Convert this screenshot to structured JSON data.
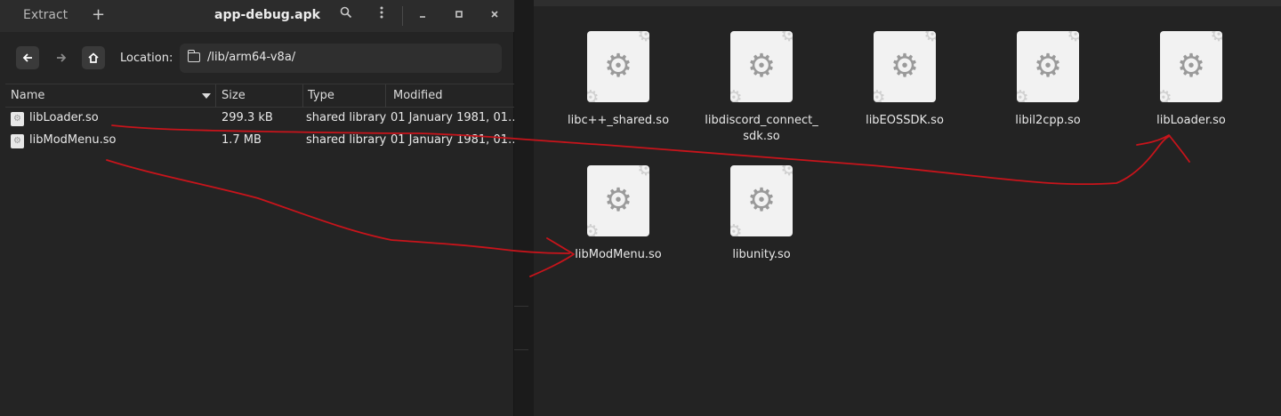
{
  "archive": {
    "title": "app-debug.apk",
    "extract_label": "Extract",
    "add_label": "+",
    "search_icon": "search-icon",
    "menu_icon": "menu-icon",
    "minimize_icon": "minimize-icon",
    "maximize_icon": "maximize-icon",
    "close_icon": "close-icon",
    "location_label": "Location:",
    "location_path": "/lib/arm64-v8a/",
    "columns": [
      "Name",
      "Size",
      "Type",
      "Modified"
    ],
    "rows": [
      {
        "name": "libLoader.so",
        "size": "299.3 kB",
        "type": "shared library",
        "modified": "01 January 1981, 01…"
      },
      {
        "name": "libModMenu.so",
        "size": "1.7 MB",
        "type": "shared library",
        "modified": "01 January 1981, 01…"
      }
    ]
  },
  "file_manager": {
    "files": [
      {
        "label": "libc++_shared.so"
      },
      {
        "label": "libdiscord_connect_ sdk.so"
      },
      {
        "label": "libEOSSDK.so"
      },
      {
        "label": "libil2cpp.so"
      },
      {
        "label": "libLoader.so"
      },
      {
        "label": "libModMenu.so"
      },
      {
        "label": "libunity.so"
      }
    ]
  },
  "annotation": {
    "color": "#c8141b"
  }
}
